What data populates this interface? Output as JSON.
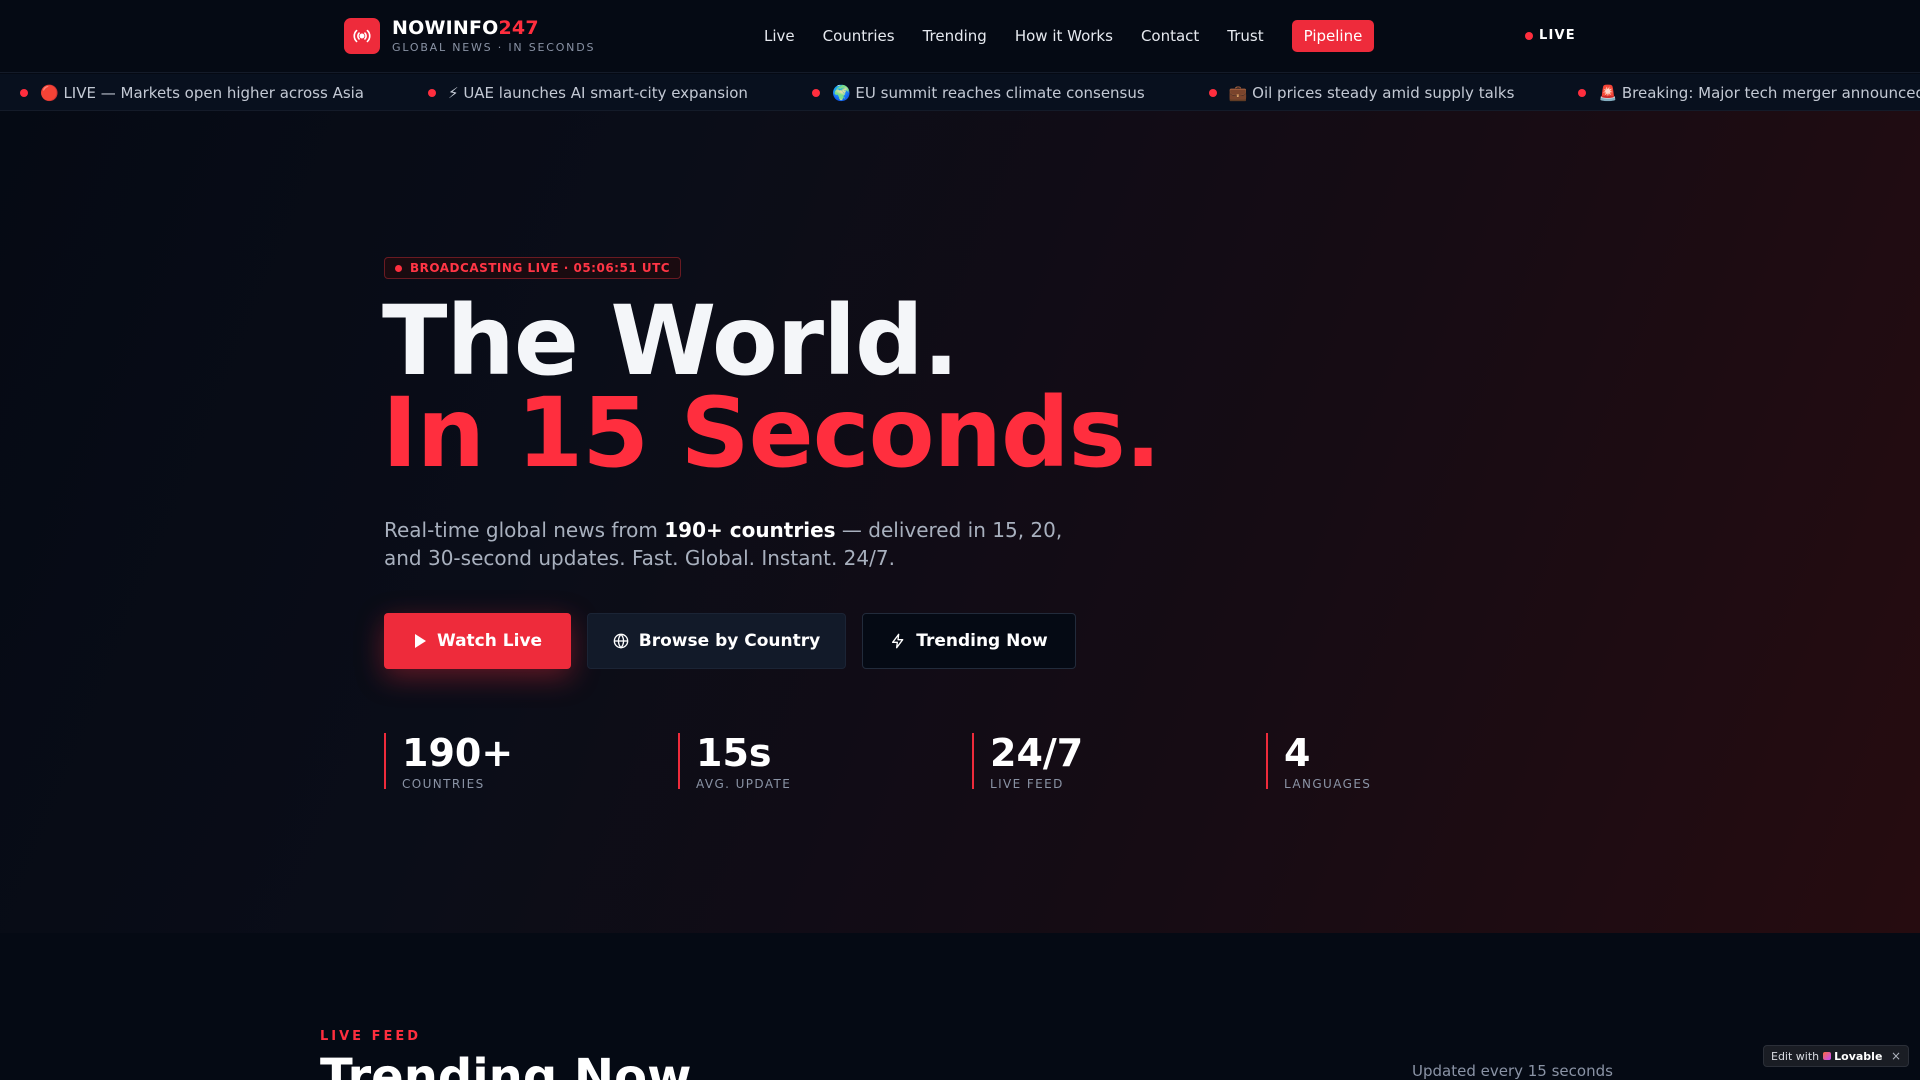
{
  "brand": {
    "name_main": "NOWINFO",
    "name_accent": "247",
    "tagline": "GLOBAL NEWS · IN SECONDS",
    "accent_color": "#ee2b3b"
  },
  "nav": {
    "items": [
      "Live",
      "Countries",
      "Trending",
      "How it Works",
      "Contact",
      "Trust"
    ],
    "pill": "Pipeline",
    "live_label": "LIVE"
  },
  "ticker": [
    "🔴 LIVE — Markets open higher across Asia",
    "⚡ UAE launches AI smart-city expansion",
    "🌍 EU summit reaches climate consensus",
    "💼 Oil prices steady amid supply talks",
    "🚨 Breaking: Major tech merger announced",
    "📈"
  ],
  "hero": {
    "badge": "BROADCASTING LIVE · 05:06:51 UTC",
    "title_line1": "The World.",
    "title_line2": "In 15 Seconds.",
    "subtitle_pre": "Real-time global news from ",
    "subtitle_bold": "190+ countries",
    "subtitle_post": " — delivered in 15, 20, and 30-second updates. Fast. Global. Instant. 24/7.",
    "buttons": {
      "watch": "Watch Live",
      "browse": "Browse by Country",
      "trending": "Trending Now"
    },
    "stats": [
      {
        "value": "190+",
        "label": "COUNTRIES"
      },
      {
        "value": "15s",
        "label": "AVG. UPDATE"
      },
      {
        "value": "24/7",
        "label": "LIVE FEED"
      },
      {
        "value": "4",
        "label": "LANGUAGES"
      }
    ]
  },
  "section": {
    "eyebrow": "LIVE FEED",
    "title": "Trending Now",
    "updated": "Updated every 15 seconds"
  },
  "lovable": {
    "prefix": "Edit with",
    "brand": "Lovable",
    "close": "×"
  }
}
